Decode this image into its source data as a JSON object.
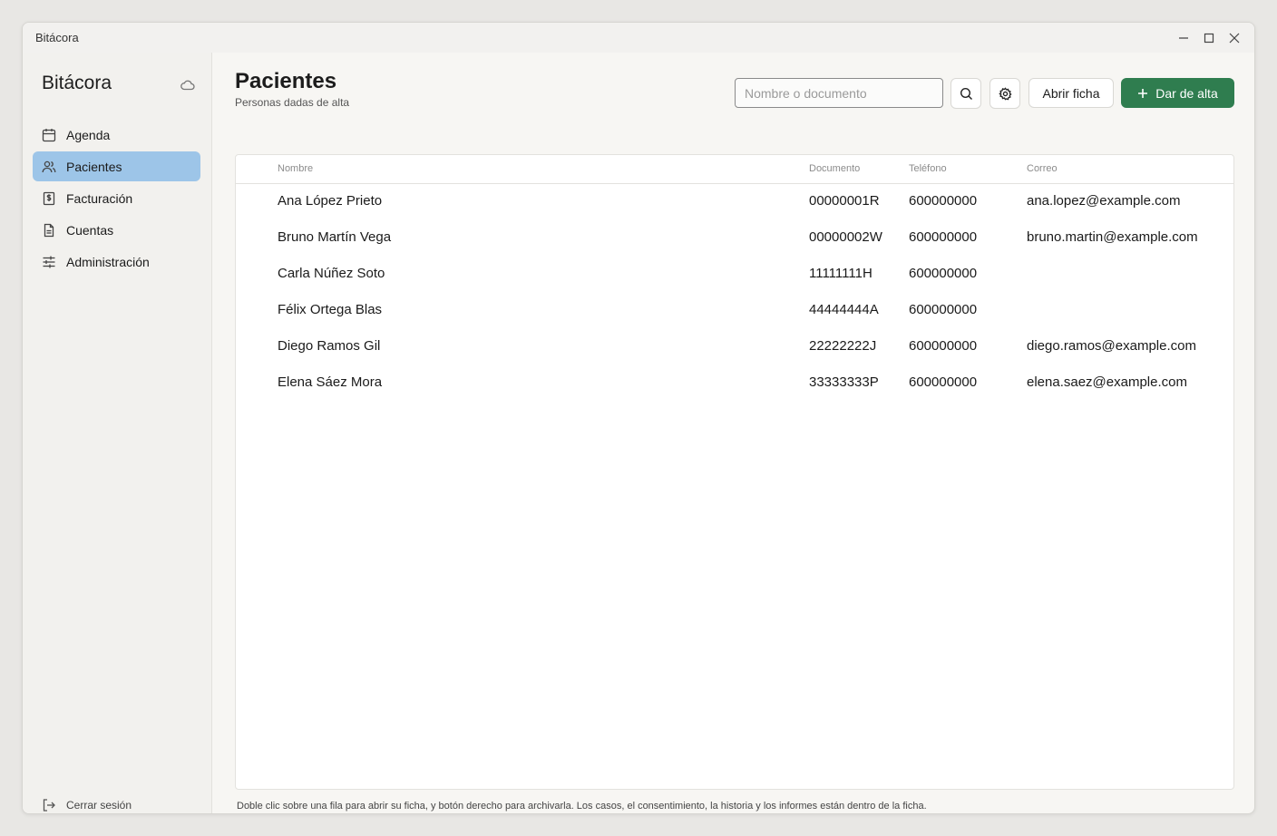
{
  "window": {
    "title": "Bitácora"
  },
  "sidebar": {
    "brand": "Bitácora",
    "cloud_icon": "cloud-icon",
    "items": [
      {
        "label": "Agenda",
        "icon": "calendar-icon",
        "active": false
      },
      {
        "label": "Pacientes",
        "icon": "users-icon",
        "active": true
      },
      {
        "label": "Facturación",
        "icon": "invoice-icon",
        "active": false
      },
      {
        "label": "Cuentas",
        "icon": "document-icon",
        "active": false
      },
      {
        "label": "Administración",
        "icon": "sliders-icon",
        "active": false
      }
    ],
    "logout_label": "Cerrar sesión"
  },
  "header": {
    "title": "Pacientes",
    "subtitle": "Personas dadas de alta",
    "search_placeholder": "Nombre o documento",
    "open_label": "Abrir ficha",
    "add_label": "Dar de alta"
  },
  "table": {
    "columns": {
      "name": "Nombre",
      "doc": "Documento",
      "tel": "Teléfono",
      "mail": "Correo"
    },
    "rows": [
      {
        "name": "Ana López Prieto",
        "doc": "00000001R",
        "tel": "600000000",
        "mail": "ana.lopez@example.com"
      },
      {
        "name": "Bruno Martín Vega",
        "doc": "00000002W",
        "tel": "600000000",
        "mail": "bruno.martin@example.com"
      },
      {
        "name": "Carla Núñez Soto",
        "doc": "11111111H",
        "tel": "600000000",
        "mail": ""
      },
      {
        "name": "Félix Ortega Blas",
        "doc": "44444444A",
        "tel": "600000000",
        "mail": ""
      },
      {
        "name": "Diego Ramos Gil",
        "doc": "22222222J",
        "tel": "600000000",
        "mail": "diego.ramos@example.com"
      },
      {
        "name": "Elena Sáez Mora",
        "doc": "33333333P",
        "tel": "600000000",
        "mail": "elena.saez@example.com"
      }
    ]
  },
  "footer_hint": "Doble clic sobre una fila para abrir su ficha, y botón derecho para archivarla. Los casos, el consentimiento, la historia y los informes están dentro de la ficha.",
  "colors": {
    "accent": "#2f7d4f",
    "selection": "#9dc5e8"
  }
}
